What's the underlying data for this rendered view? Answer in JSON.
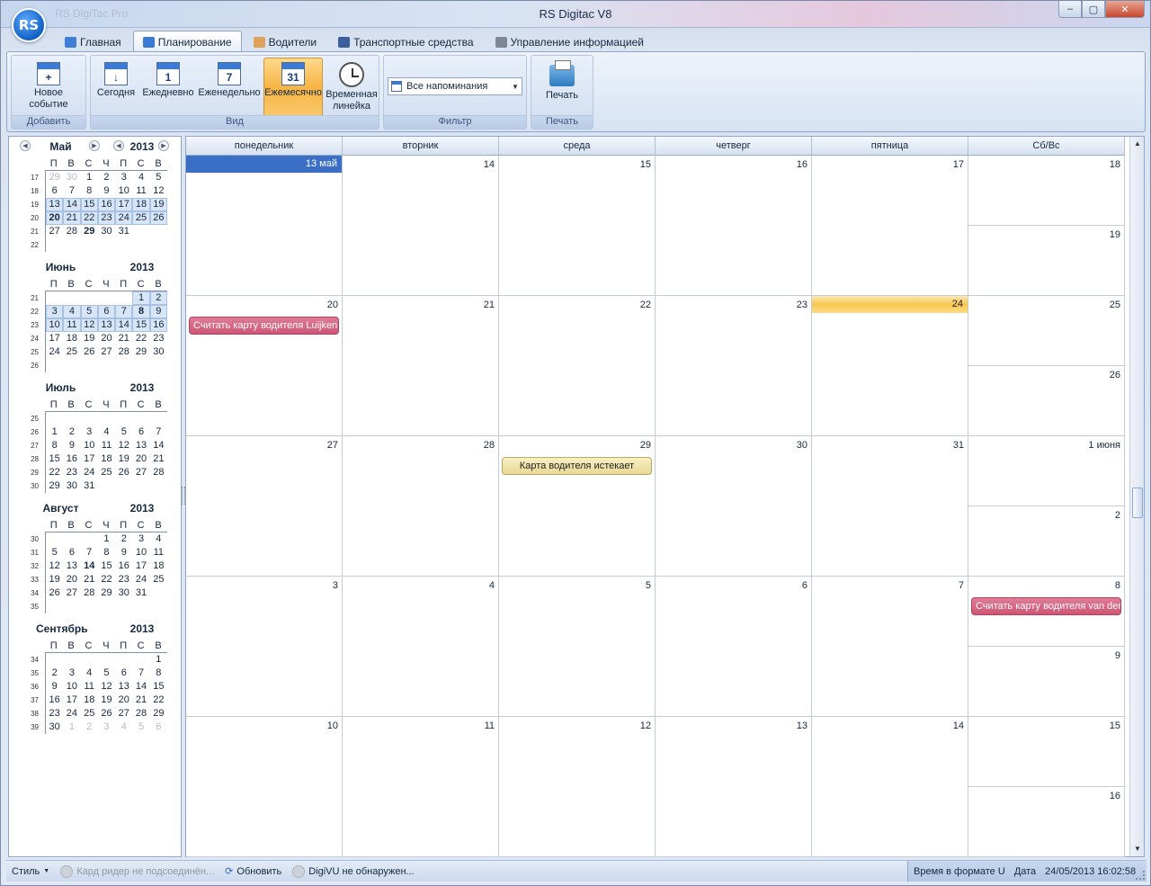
{
  "window": {
    "title": "RS Digitac V8",
    "faded_title": "RS DigiTac Pro",
    "logo_text": "RS"
  },
  "tabs": [
    {
      "label": "Главная",
      "color": "#3d7ed8"
    },
    {
      "label": "Планирование",
      "color": "#3a7bd5"
    },
    {
      "label": "Водители",
      "color": "#e0a25a"
    },
    {
      "label": "Транспортные средства",
      "color": "#3b5f9e"
    },
    {
      "label": "Управление информацией",
      "color": "#7d8797"
    }
  ],
  "ribbon": {
    "add_group": {
      "label": "Добавить",
      "new_event": "Новое событие"
    },
    "view_group": {
      "label": "Вид",
      "today": "Сегодня",
      "daily": "Ежедневно",
      "daily_num": "1",
      "weekly": "Еженедельно",
      "weekly_num": "7",
      "monthly": "Ежемесячно",
      "monthly_num": "31",
      "timeline": "Временная линейка"
    },
    "filter_group": {
      "label": "Фильтр",
      "selected": "Все напоминания"
    },
    "print_group": {
      "label": "Печать",
      "print": "Печать"
    }
  },
  "mini_calendar": {
    "dow": [
      "П",
      "В",
      "С",
      "Ч",
      "П",
      "С",
      "В"
    ],
    "months": [
      {
        "name": "Май",
        "year": "2013",
        "weeks": [
          "17",
          "18",
          "19",
          "20",
          "21",
          "22"
        ],
        "rows": [
          [
            "29",
            "30",
            "1",
            "2",
            "3",
            "4",
            "5"
          ],
          [
            "6",
            "7",
            "8",
            "9",
            "10",
            "11",
            "12"
          ],
          [
            "13",
            "14",
            "15",
            "16",
            "17",
            "18",
            "19"
          ],
          [
            "20",
            "21",
            "22",
            "23",
            "24",
            "25",
            "26"
          ],
          [
            "27",
            "28",
            "29",
            "30",
            "31",
            "",
            ""
          ],
          [
            "",
            "",
            "",
            "",
            "",
            "",
            ""
          ]
        ]
      },
      {
        "name": "Июнь",
        "year": "2013",
        "weeks": [
          "21",
          "22",
          "23",
          "24",
          "25",
          "26"
        ],
        "rows": [
          [
            "",
            "",
            "",
            "",
            "",
            "1",
            "2"
          ],
          [
            "3",
            "4",
            "5",
            "6",
            "7",
            "8",
            "9"
          ],
          [
            "10",
            "11",
            "12",
            "13",
            "14",
            "15",
            "16"
          ],
          [
            "17",
            "18",
            "19",
            "20",
            "21",
            "22",
            "23"
          ],
          [
            "24",
            "25",
            "26",
            "27",
            "28",
            "29",
            "30"
          ],
          [
            "",
            "",
            "",
            "",
            "",
            "",
            ""
          ]
        ]
      },
      {
        "name": "Июль",
        "year": "2013",
        "weeks": [
          "25",
          "26",
          "27",
          "28",
          "29",
          "30"
        ],
        "rows": [
          [
            "",
            "",
            "",
            "",
            "",
            "",
            ""
          ],
          [
            "1",
            "2",
            "3",
            "4",
            "5",
            "6",
            "7"
          ],
          [
            "8",
            "9",
            "10",
            "11",
            "12",
            "13",
            "14"
          ],
          [
            "15",
            "16",
            "17",
            "18",
            "19",
            "20",
            "21"
          ],
          [
            "22",
            "23",
            "24",
            "25",
            "26",
            "27",
            "28"
          ],
          [
            "29",
            "30",
            "31",
            "",
            "",
            "",
            ""
          ]
        ]
      },
      {
        "name": "Август",
        "year": "2013",
        "weeks": [
          "30",
          "31",
          "32",
          "33",
          "34",
          "35"
        ],
        "rows": [
          [
            "",
            "",
            "",
            "1",
            "2",
            "3",
            "4"
          ],
          [
            "5",
            "6",
            "7",
            "8",
            "9",
            "10",
            "11"
          ],
          [
            "12",
            "13",
            "14",
            "15",
            "16",
            "17",
            "18"
          ],
          [
            "19",
            "20",
            "21",
            "22",
            "23",
            "24",
            "25"
          ],
          [
            "26",
            "27",
            "28",
            "29",
            "30",
            "31",
            ""
          ],
          [
            "",
            "",
            "",
            "",
            "",
            "",
            ""
          ]
        ]
      },
      {
        "name": "Сентябрь",
        "year": "2013",
        "weeks": [
          "34",
          "35",
          "36",
          "37",
          "38",
          "39"
        ],
        "rows": [
          [
            "",
            "",
            "",
            "",
            "",
            "",
            "1"
          ],
          [
            "2",
            "3",
            "4",
            "5",
            "6",
            "7",
            "8"
          ],
          [
            "9",
            "10",
            "11",
            "12",
            "13",
            "14",
            "15"
          ],
          [
            "16",
            "17",
            "18",
            "19",
            "20",
            "21",
            "22"
          ],
          [
            "23",
            "24",
            "25",
            "26",
            "27",
            "28",
            "29"
          ],
          [
            "30",
            "1",
            "2",
            "3",
            "4",
            "5",
            "6"
          ]
        ]
      }
    ]
  },
  "calendar": {
    "headers": [
      "понедельник",
      "вторник",
      "среда",
      "четверг",
      "пятница",
      "Сб/Вс"
    ],
    "weeks": [
      {
        "days": [
          "13 май",
          "14",
          "15",
          "16",
          "17"
        ],
        "sat": "18",
        "sun": "19"
      },
      {
        "days": [
          "20",
          "21",
          "22",
          "23",
          "24"
        ],
        "sat": "25",
        "sun": "26"
      },
      {
        "days": [
          "27",
          "28",
          "29",
          "30",
          "31"
        ],
        "sat": "1 июня",
        "sun": "2"
      },
      {
        "days": [
          "3",
          "4",
          "5",
          "6",
          "7"
        ],
        "sat": "8",
        "sun": "9"
      },
      {
        "days": [
          "10",
          "11",
          "12",
          "13",
          "14"
        ],
        "sat": "15",
        "sun": "16"
      }
    ],
    "events": [
      {
        "text": "Считать карту водителя Luijken",
        "week": 1,
        "day": 0,
        "style": "red"
      },
      {
        "text": "Карта водителя истекает",
        "week": 2,
        "day": 2,
        "style": "yellow"
      },
      {
        "text": "Считать карту водителя van der",
        "week": 3,
        "day": 5,
        "style": "red"
      }
    ],
    "today_label": "13 май",
    "current_day": "24"
  },
  "status": {
    "style": "Стиль",
    "card_reader": "Кард ридер не подсоединён...",
    "refresh": "Обновить",
    "digivu": "DigiVU не обнаружен...",
    "time_format": "Время в формате U",
    "date_label": "Дата",
    "datetime": "24/05/2013 16:02:58"
  }
}
